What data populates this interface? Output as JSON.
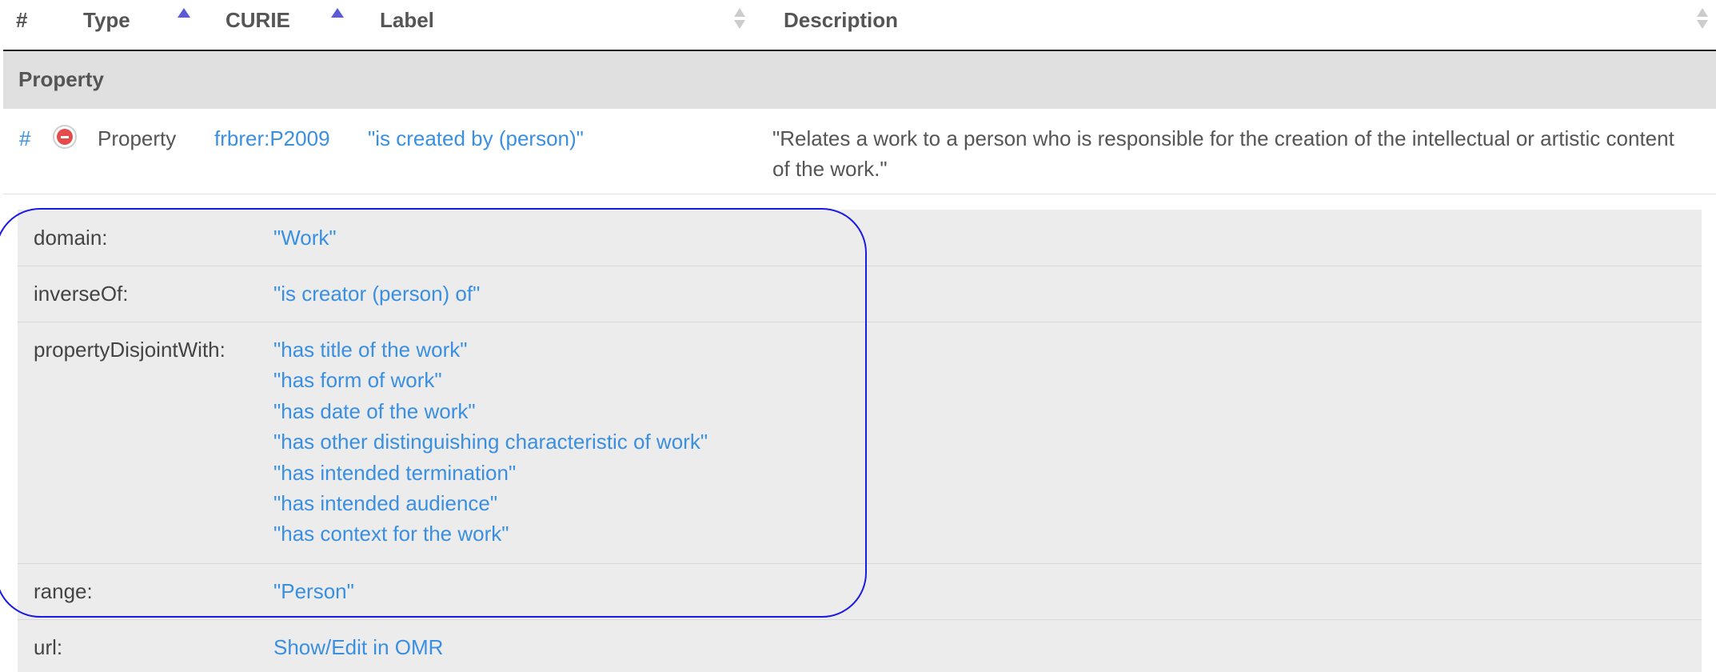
{
  "header": {
    "hash": "#",
    "type": "Type",
    "curie": "CURIE",
    "label": "Label",
    "description": "Description"
  },
  "group": {
    "title": "Property"
  },
  "row": {
    "hash": "#",
    "type": "Property",
    "curie": "frbrer:P2009",
    "label": "\"is created by (person)\"",
    "description": "\"Relates a work to a person who is responsible for the creation of the intellectual or artistic content of the work.\""
  },
  "details": {
    "domain": {
      "label": "domain:",
      "values": [
        "\"Work\""
      ]
    },
    "inverseOf": {
      "label": "inverseOf:",
      "values": [
        "\"is creator (person) of\""
      ]
    },
    "propertyDisjointWith": {
      "label": "propertyDisjointWith:",
      "values": [
        "\"has title of the work\"",
        "\"has form of work\"",
        "\"has date of the work\"",
        "\"has other distinguishing characteristic of work\"",
        "\"has intended termination\"",
        "\"has intended audience\"",
        "\"has context for the work\""
      ]
    },
    "range": {
      "label": "range:",
      "values": [
        "\"Person\""
      ]
    },
    "url": {
      "label": "url:",
      "values": [
        "Show/Edit in OMR"
      ]
    }
  },
  "colors": {
    "link": "#3a8fe0",
    "sort_active": "#5b5bd6",
    "group_bg": "#e0e0e0",
    "details_bg": "#ececec",
    "highlight": "#1a1ae6",
    "remove": "#e64b4b"
  }
}
